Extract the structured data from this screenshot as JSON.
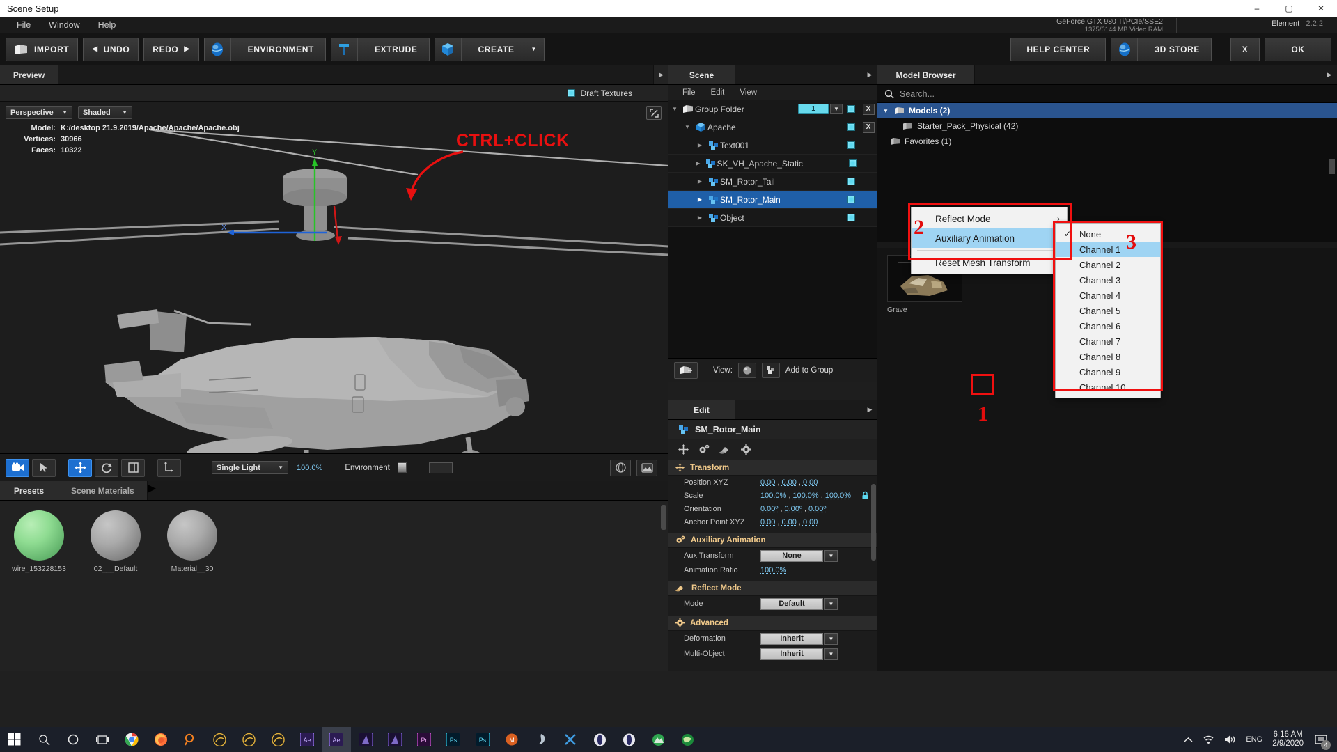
{
  "window": {
    "title": "Scene Setup",
    "minimize": "–",
    "maximize": "▢",
    "close": "✕"
  },
  "menubar": {
    "items": [
      "File",
      "Window",
      "Help"
    ]
  },
  "gpu": {
    "line1": "GeForce GTX 980 Ti/PCIe/SSE2",
    "line2": "1375/6144 MB Video RAM",
    "product": "Element",
    "version": "2.2.2"
  },
  "toolbar": {
    "import": "IMPORT",
    "undo": "UNDO",
    "redo": "REDO",
    "environment": "ENVIRONMENT",
    "extrude": "EXTRUDE",
    "create": "CREATE",
    "help_center": "HELP CENTER",
    "store": "3D STORE",
    "cancel": "X",
    "ok": "OK"
  },
  "preview": {
    "tab": "Preview",
    "draft_textures": "Draft Textures",
    "view_mode": "Perspective",
    "shading": "Shaded",
    "info": {
      "model_label": "Model:",
      "model_value": "K:/desktop 21.9.2019/Apache/Apache/Apache.obj",
      "vertices_label": "Vertices:",
      "vertices_value": "30966",
      "faces_label": "Faces:",
      "faces_value": "10322"
    },
    "annotation": "CTRL+CLICK"
  },
  "viewport_bottom": {
    "light_preset": "Single Light",
    "light_pct": "100.0%",
    "environment_label": "Environment"
  },
  "material_tabs": {
    "presets": "Presets",
    "scene_materials": "Scene Materials"
  },
  "materials": [
    {
      "name": "wire_153228153",
      "color": "#8fdc92"
    },
    {
      "name": "02___Default",
      "color": "#aaaaaa"
    },
    {
      "name": "Material__30",
      "color": "#aaaaaa"
    }
  ],
  "scene": {
    "title": "Scene",
    "menu": [
      "File",
      "Edit",
      "View"
    ],
    "tree": [
      {
        "label": "Group Folder",
        "indent": 0,
        "icon": "folder-icon",
        "expanded": true,
        "badge": "1",
        "has_badge": true,
        "check": true,
        "x": true,
        "selected": false
      },
      {
        "label": "Apache",
        "indent": 1,
        "icon": "cube-icon",
        "expanded": true,
        "has_badge": false,
        "check": true,
        "x": true,
        "selected": false
      },
      {
        "label": "Text001",
        "indent": 2,
        "icon": "mesh-icon",
        "expanded": false,
        "has_badge": false,
        "check": true,
        "x": false,
        "selected": false
      },
      {
        "label": "SK_VH_Apache_Static",
        "indent": 2,
        "icon": "mesh-icon",
        "expanded": false,
        "has_badge": false,
        "check": true,
        "x": false,
        "selected": false
      },
      {
        "label": "SM_Rotor_Tail",
        "indent": 2,
        "icon": "mesh-icon",
        "expanded": false,
        "has_badge": false,
        "check": true,
        "x": false,
        "selected": false
      },
      {
        "label": "SM_Rotor_Main",
        "indent": 2,
        "icon": "mesh-icon",
        "expanded": false,
        "has_badge": false,
        "check": true,
        "x": false,
        "selected": true
      },
      {
        "label": "Object",
        "indent": 2,
        "icon": "mesh-icon",
        "expanded": false,
        "has_badge": false,
        "check": true,
        "x": false,
        "selected": false
      }
    ],
    "footer": {
      "view_label": "View:",
      "add_to_group": "Add to Group"
    }
  },
  "context_menu": {
    "items": [
      {
        "label": "Reflect Mode",
        "submenu": true,
        "highlight": false
      },
      {
        "label": "Auxiliary Animation",
        "submenu": true,
        "highlight": true
      },
      {
        "label": "Reset Mesh Transform",
        "submenu": false,
        "highlight": false
      }
    ]
  },
  "channel_menu": {
    "items": [
      {
        "label": "None",
        "checked": true,
        "highlight": false
      },
      {
        "label": "Channel 1",
        "checked": false,
        "highlight": true
      },
      {
        "label": "Channel 2",
        "checked": false,
        "highlight": false
      },
      {
        "label": "Channel 3",
        "checked": false,
        "highlight": false
      },
      {
        "label": "Channel 4",
        "checked": false,
        "highlight": false
      },
      {
        "label": "Channel 5",
        "checked": false,
        "highlight": false
      },
      {
        "label": "Channel 6",
        "checked": false,
        "highlight": false
      },
      {
        "label": "Channel 7",
        "checked": false,
        "highlight": false
      },
      {
        "label": "Channel 8",
        "checked": false,
        "highlight": false
      },
      {
        "label": "Channel 9",
        "checked": false,
        "highlight": false
      },
      {
        "label": "Channel 10",
        "checked": false,
        "highlight": false
      }
    ]
  },
  "callouts": {
    "one": "1",
    "two": "2",
    "three": "3"
  },
  "edit": {
    "title": "Edit",
    "object_name": "SM_Rotor_Main",
    "sections": {
      "transform": {
        "title": "Transform",
        "rows": [
          {
            "key": "Position XYZ",
            "v1": "0.00",
            "v2": "0.00",
            "v3": "0.00"
          },
          {
            "key": "Scale",
            "v1": "100.0%",
            "v2": "100.0%",
            "v3": "100.0%",
            "lock": true
          },
          {
            "key": "Orientation",
            "v1": "0.00º",
            "v2": "0.00º",
            "v3": "0.00º"
          },
          {
            "key": "Anchor Point XYZ",
            "v1": "0.00",
            "v2": "0.00",
            "v3": "0.00"
          }
        ]
      },
      "auxiliary_animation": {
        "title": "Auxiliary Animation",
        "aux_transform_label": "Aux Transform",
        "aux_transform_value": "None",
        "animation_ratio_label": "Animation Ratio",
        "animation_ratio_value": "100.0%"
      },
      "reflect_mode": {
        "title": "Reflect Mode",
        "mode_label": "Mode",
        "mode_value": "Default"
      },
      "advanced": {
        "title": "Advanced",
        "deformation_label": "Deformation",
        "deformation_value": "Inherit",
        "multi_object_label": "Multi-Object",
        "multi_object_value": "Inherit"
      }
    }
  },
  "model_browser": {
    "title": "Model Browser",
    "search_placeholder": "Search...",
    "tree": [
      {
        "label": "Models (2)",
        "indent": 0,
        "expanded": true,
        "selected": true
      },
      {
        "label": "Starter_Pack_Physical (42)",
        "indent": 1,
        "expanded": false,
        "selected": false
      },
      {
        "label": "Favorites (1)",
        "indent": 0,
        "expanded": false,
        "selected": false
      }
    ],
    "thumbnails": [
      {
        "caption": "Grave"
      }
    ]
  },
  "taskbar": {
    "apps": [
      "windows-start-icon",
      "search-icon",
      "cortana-icon",
      "task-view-icon",
      "chrome-icon",
      "firefox-icon",
      "search-orange-icon",
      "cinema4d-icon",
      "cinema4d-icon",
      "cinema4d-icon",
      "after-effects-icon",
      "after-effects-icon",
      "premiere-dark-icon",
      "premiere-dark-icon",
      "premiere-icon",
      "photoshop-icon",
      "photoshop-icon",
      "houdini-icon",
      "vortex-icon",
      "x-icon",
      "opera-icon",
      "opera-icon",
      "peak-icon",
      "globe-icon"
    ],
    "language": "ENG",
    "time": "6:16 AM",
    "date": "2/9/2020",
    "notification_count": "4"
  }
}
